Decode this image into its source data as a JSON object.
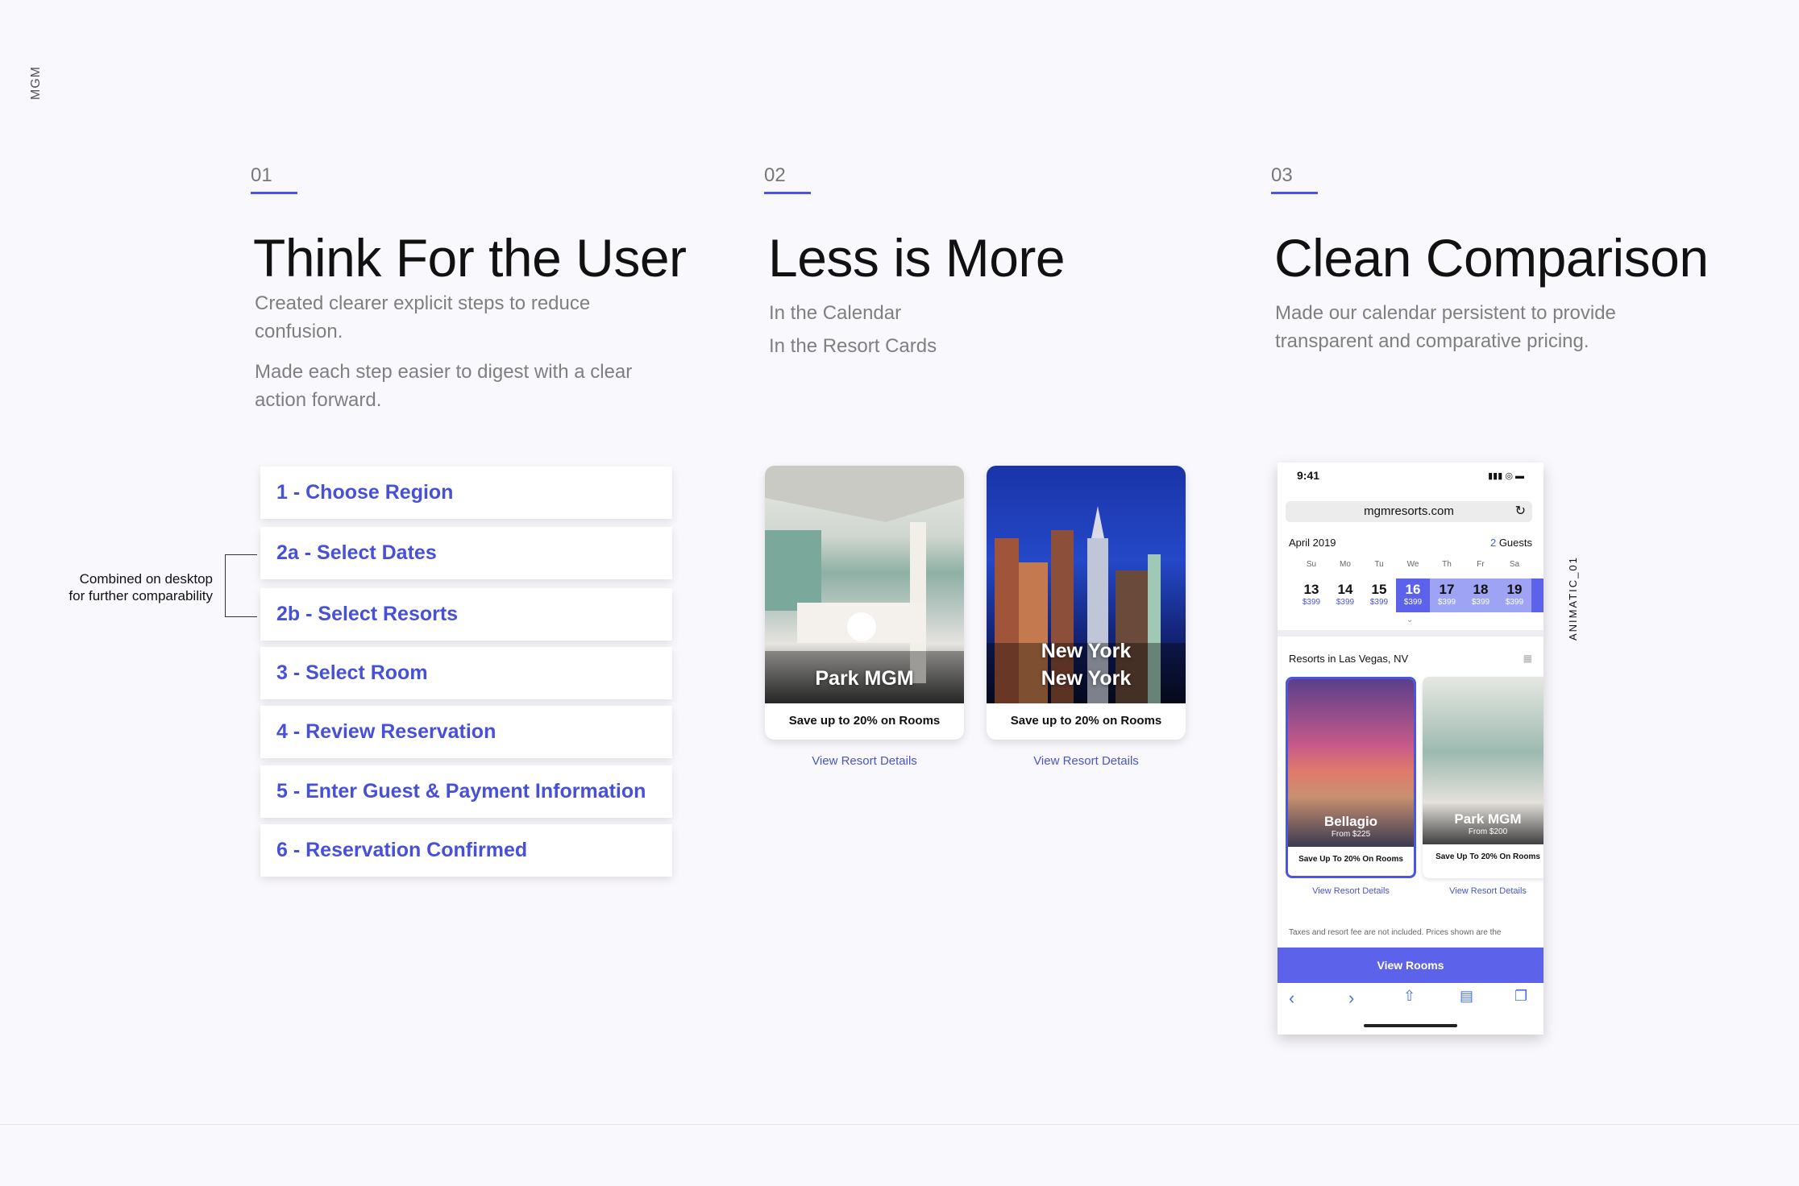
{
  "brand": "MGM",
  "sections": [
    {
      "number": "01",
      "title": "Think For the User",
      "desc": [
        "Created clearer explicit steps to reduce confusion.",
        "Made each step easier to digest with a clear action forward."
      ]
    },
    {
      "number": "02",
      "title": "Less is More",
      "desc": [
        "In the Calendar",
        "In the Resort Cards"
      ]
    },
    {
      "number": "03",
      "title": "Clean Comparison",
      "desc": [
        "Made our calendar persistent to provide transparent and comparative pricing."
      ]
    }
  ],
  "steps": [
    "1 - Choose Region",
    "2a - Select Dates",
    "2b - Select Resorts",
    "3 - Select Room",
    "4 - Review Reservation",
    "5 - Enter Guest & Payment Information",
    "6 - Reservation Confirmed"
  ],
  "combined_note": [
    "Combined on desktop",
    "for further comparability"
  ],
  "resort_cards": [
    {
      "name_line1": "Park MGM",
      "name_line2": "",
      "save": "Save up to 20% on Rooms",
      "link": "View Resort Details"
    },
    {
      "name_line1": "New York",
      "name_line2": "New York",
      "save": "Save up to 20% on Rooms",
      "link": "View Resort Details"
    }
  ],
  "phone": {
    "time": "9:41",
    "url": "mgmresorts.com",
    "month": "April 2019",
    "guests_num": "2",
    "guests_label": "Guests",
    "days": [
      "Su",
      "Mo",
      "Tu",
      "We",
      "Th",
      "Fr",
      "Sa"
    ],
    "dates": [
      {
        "d": "13",
        "p": "$399"
      },
      {
        "d": "14",
        "p": "$399"
      },
      {
        "d": "15",
        "p": "$399"
      },
      {
        "d": "16",
        "p": "$399"
      },
      {
        "d": "17",
        "p": "$399"
      },
      {
        "d": "18",
        "p": "$399"
      },
      {
        "d": "19",
        "p": "$399"
      }
    ],
    "resorts_in": "Resorts in Las Vegas, NV",
    "cards": [
      {
        "name": "Bellagio",
        "from": "From $225",
        "save": "Save Up To 20% On Rooms",
        "link": "View Resort Details"
      },
      {
        "name": "Park MGM",
        "from": "From $200",
        "save": "Save Up To 20% On Rooms",
        "link": "View Resort Details"
      }
    ],
    "taxes": "Taxes and resort fee are not included. Prices shown are the",
    "view_rooms": "View Rooms"
  },
  "animatic_label": "ANIMATIC_01"
}
